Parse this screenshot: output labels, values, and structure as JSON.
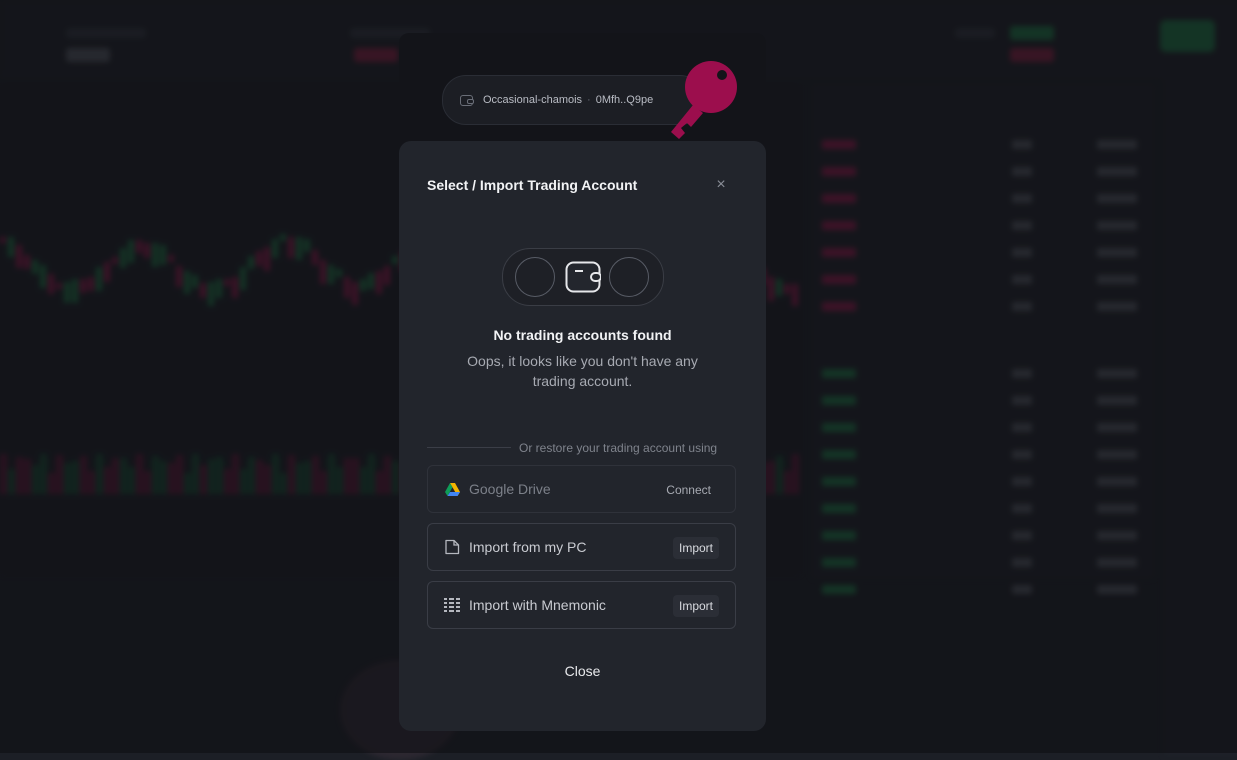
{
  "wallet": {
    "name": "Occasional-chamois",
    "separator": "·",
    "address": "0Mfh..Q9pe"
  },
  "modal": {
    "title": "Select / Import Trading Account",
    "empty_title": "No trading accounts found",
    "empty_description": "Oops, it looks like you don't have any trading account.",
    "restore_text": "Or restore your trading account using",
    "options": [
      {
        "label": "Google Drive",
        "action": "Connect",
        "icon": "google-drive-icon",
        "disabled": true
      },
      {
        "label": "Import from my PC",
        "action": "Import",
        "icon": "file-icon",
        "disabled": false
      },
      {
        "label": "Import with Mnemonic",
        "action": "Import",
        "icon": "grid-icon",
        "disabled": false
      }
    ],
    "close_label": "Close",
    "close_icon": "close-icon"
  },
  "colors": {
    "accent_pink": "#9c0e4d",
    "modal_bg": "#22252c",
    "header_bg": "#131419",
    "up_green": "#1f9d55",
    "down_red": "#c2185b"
  }
}
